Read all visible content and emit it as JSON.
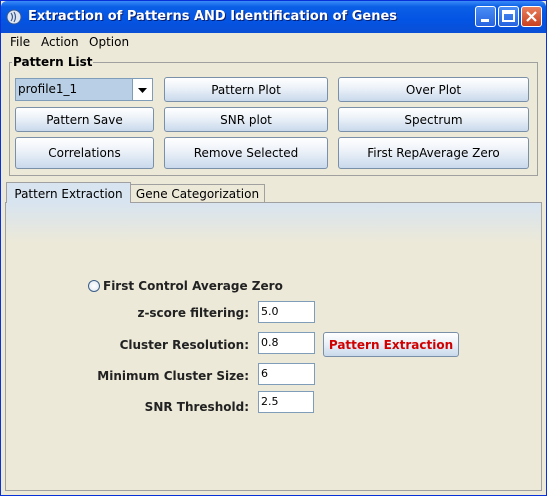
{
  "window": {
    "title": "Extraction of Patterns AND Identification of Genes"
  },
  "menu": {
    "items": [
      "File",
      "Action",
      "Option"
    ]
  },
  "pattern_list": {
    "legend": "Pattern List",
    "combo_value": "profile1_1",
    "buttons": {
      "pattern_plot": "Pattern Plot",
      "over_plot": "Over Plot",
      "pattern_save": "Pattern Save",
      "snr_plot": "SNR plot",
      "spectrum": "Spectrum",
      "correlations": "Correlations",
      "remove_selected": "Remove Selected",
      "first_rep_average_zero": "First RepAverage Zero"
    }
  },
  "tabs": [
    {
      "label": "Pattern Extraction",
      "active": true
    },
    {
      "label": "Gene Categorization",
      "active": false
    }
  ],
  "pattern_extraction": {
    "radio_label": "First Control Average Zero",
    "fields": {
      "zscore_label": "z-score filtering:",
      "zscore_value": "5.0",
      "cluster_resolution_label": "Cluster Resolution:",
      "cluster_resolution_value": "0.8",
      "min_cluster_size_label": "Minimum Cluster Size:",
      "min_cluster_size_value": "6",
      "snr_threshold_label": "SNR Threshold:",
      "snr_threshold_value": "2.5"
    },
    "extract_button": "Pattern Extraction"
  },
  "colors": {
    "accent": "#d00000",
    "titlebar": "#0454e3"
  }
}
